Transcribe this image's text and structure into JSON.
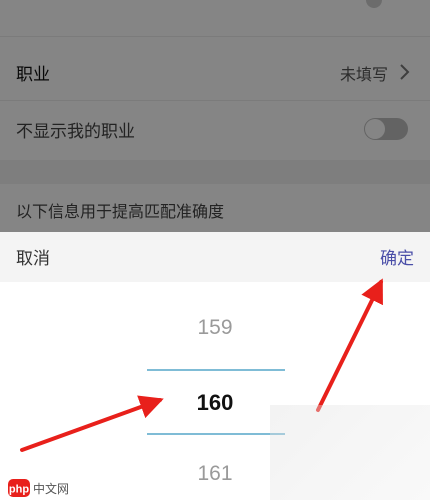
{
  "settings": {
    "job": {
      "label": "职业",
      "value": "未填写"
    },
    "hide_job": {
      "label": "不显示我的职业",
      "enabled": false
    },
    "info_text": "以下信息用于提高匹配准确度"
  },
  "picker": {
    "cancel_label": "取消",
    "confirm_label": "确定",
    "options": {
      "prev": "159",
      "selected": "160",
      "next": "161"
    },
    "accent_color": "#4a4ea8",
    "selection_line_color": "#7fbcd6"
  },
  "annotation": {
    "arrow_color": "#e8201b"
  },
  "watermark": {
    "text": "php中文网"
  }
}
